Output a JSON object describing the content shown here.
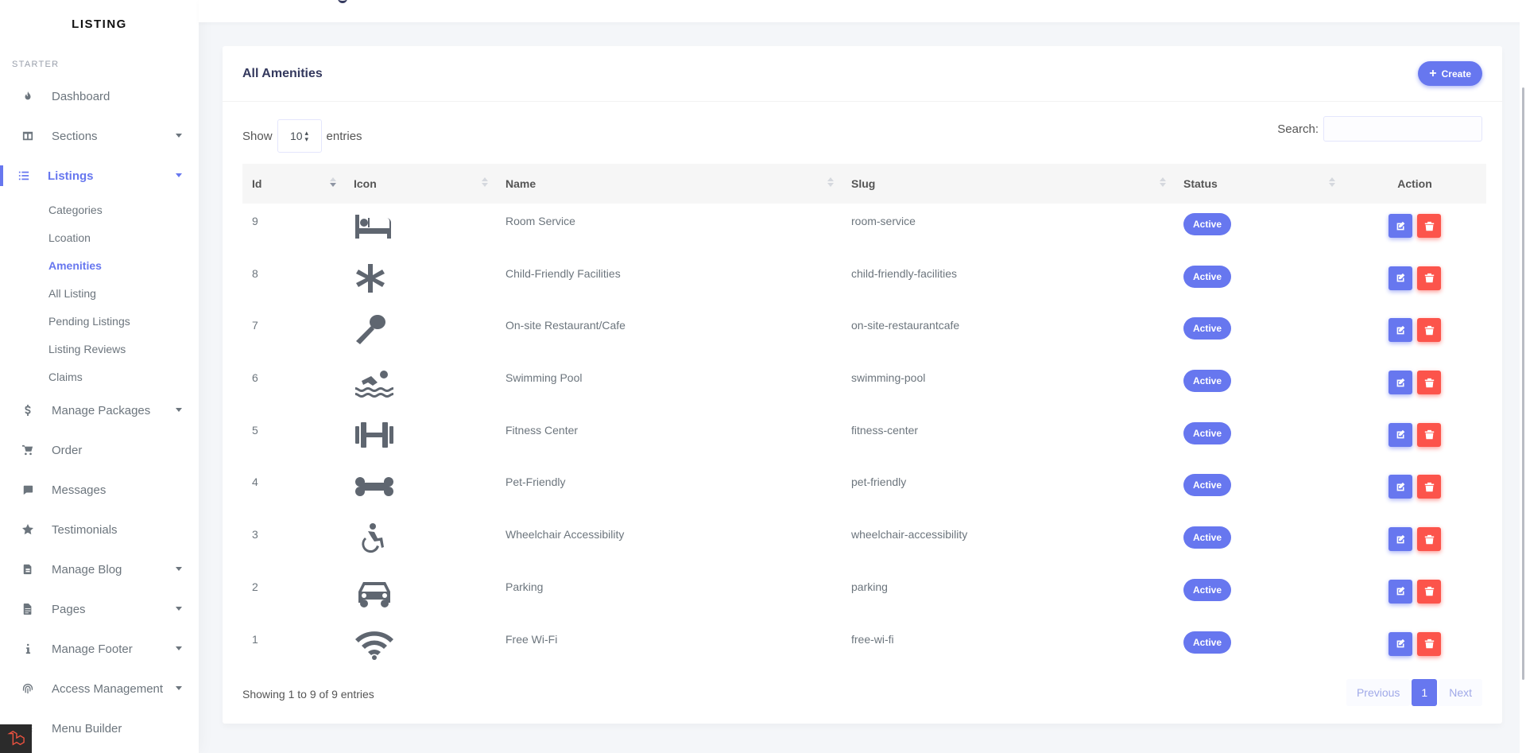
{
  "sidebar": {
    "brand": "LISTING",
    "section_header": "STARTER",
    "items": [
      {
        "label": "Dashboard",
        "icon": "fire-icon"
      },
      {
        "label": "Sections",
        "icon": "columns-icon",
        "dropdown": true
      },
      {
        "label": "Listings",
        "icon": "list-icon",
        "dropdown": true,
        "active": true
      },
      {
        "label": "Manage Packages",
        "icon": "dollar-icon",
        "dropdown": true
      },
      {
        "label": "Order",
        "icon": "cart-icon"
      },
      {
        "label": "Messages",
        "icon": "message-icon"
      },
      {
        "label": "Testimonials",
        "icon": "star-icon"
      },
      {
        "label": "Manage Blog",
        "icon": "blog-icon",
        "dropdown": true
      },
      {
        "label": "Pages",
        "icon": "file-icon",
        "dropdown": true
      },
      {
        "label": "Manage Footer",
        "icon": "info-icon",
        "dropdown": true
      },
      {
        "label": "Access Management",
        "icon": "fingerprint-icon",
        "dropdown": true
      },
      {
        "label": "Menu Builder",
        "icon": "menu-builder-icon"
      }
    ],
    "listings_submenu": [
      "Categories",
      "Lcoation",
      "Amenities",
      "All Listing",
      "Pending Listings",
      "Listing Reviews",
      "Claims"
    ],
    "active_sub": "Amenities"
  },
  "card": {
    "title": "All Amenities",
    "create_label": "Create"
  },
  "controls": {
    "show_label": "Show",
    "entries_value": "10",
    "entries_label": "entries",
    "search_label": "Search:"
  },
  "table": {
    "columns": [
      "Id",
      "Icon",
      "Name",
      "Slug",
      "Status",
      "Action"
    ],
    "rows": [
      {
        "id": "9",
        "icon": "bed-icon",
        "name": "Room Service",
        "slug": "room-service",
        "status": "Active"
      },
      {
        "id": "8",
        "icon": "asterisk-icon",
        "name": "Child-Friendly Facilities",
        "slug": "child-friendly-facilities",
        "status": "Active"
      },
      {
        "id": "7",
        "icon": "spoon-icon",
        "name": "On-site Restaurant/Cafe",
        "slug": "on-site-restaurantcafe",
        "status": "Active"
      },
      {
        "id": "6",
        "icon": "swimmer-icon",
        "name": "Swimming Pool",
        "slug": "swimming-pool",
        "status": "Active"
      },
      {
        "id": "5",
        "icon": "dumbbell-icon",
        "name": "Fitness Center",
        "slug": "fitness-center",
        "status": "Active"
      },
      {
        "id": "4",
        "icon": "bone-icon",
        "name": "Pet-Friendly",
        "slug": "pet-friendly",
        "status": "Active"
      },
      {
        "id": "3",
        "icon": "wheelchair-icon",
        "name": "Wheelchair Accessibility",
        "slug": "wheelchair-accessibility",
        "status": "Active"
      },
      {
        "id": "2",
        "icon": "car-icon",
        "name": "Parking",
        "slug": "parking",
        "status": "Active"
      },
      {
        "id": "1",
        "icon": "wifi-icon",
        "name": "Free Wi-Fi",
        "slug": "free-wi-fi",
        "status": "Active"
      }
    ]
  },
  "footer": {
    "info": "Showing 1 to 9 of 9 entries",
    "previous": "Previous",
    "current_page": "1",
    "next": "Next"
  },
  "colors": {
    "primary": "#6777ef",
    "danger": "#fc544b"
  }
}
